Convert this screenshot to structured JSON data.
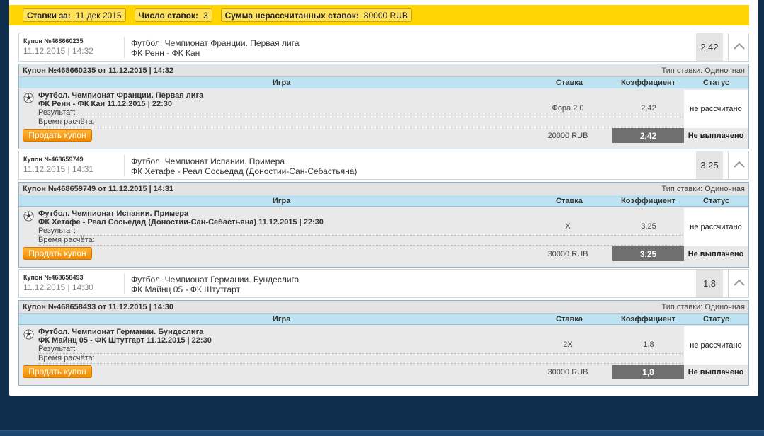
{
  "summary": {
    "bets_for_label": "Ставки за:",
    "bets_for_value": "11 дек 2015",
    "count_label": "Число ставок:",
    "count_value": "3",
    "unsettled_label": "Сумма нерассчитанных ставок:",
    "unsettled_value": "80000 RUB"
  },
  "columns": {
    "game": "Игра",
    "bet": "Ставка",
    "coef": "Коэффициент",
    "status": "Статус"
  },
  "labels": {
    "result": "Результат:",
    "settle_time": "Время расчёта:",
    "sell_button": "Продать купон",
    "bet_type_prefix": "Тип ставки:"
  },
  "coupons": [
    {
      "number": "Купон №468660235",
      "datetime": "11.12.2015 | 14:32",
      "event_line1": "Футбол. Чемпионат Франции. Первая лига",
      "event_line2": "ФК Ренн - ФК Кан",
      "coef": "2,42",
      "detail_title": "Купон №468660235 от 11.12.2015 | 14:32",
      "bet_type": "Тип ставки: Одиночная",
      "detail_event1": "Футбол. Чемпионат Франции. Первая лига",
      "detail_event2": "ФК Ренн - ФК Кан 11.12.2015 | 22:30",
      "bet": "Фора 2 0",
      "bet_coef": "2,42",
      "status": "не рассчитано",
      "stake": "20000 RUB",
      "total_coef": "2,42",
      "payout": "Не выплачено"
    },
    {
      "number": "Купон №468659749",
      "datetime": "11.12.2015 | 14:31",
      "event_line1": "Футбол. Чемпионат Испании. Примера",
      "event_line2": "ФК Хетафе - Реал Сосьедад (Доностии-Сан-Себастьяна)",
      "coef": "3,25",
      "detail_title": "Купон №468659749 от 11.12.2015 | 14:31",
      "bet_type": "Тип ставки: Одиночная",
      "detail_event1": "Футбол. Чемпионат Испании. Примера",
      "detail_event2": "ФК Хетафе - Реал Сосьедад (Доностии-Сан-Себастьяна) 11.12.2015 | 22:30",
      "bet": "X",
      "bet_coef": "3,25",
      "status": "не рассчитано",
      "stake": "30000 RUB",
      "total_coef": "3,25",
      "payout": "Не выплачено"
    },
    {
      "number": "Купон №468658493",
      "datetime": "11.12.2015 | 14:30",
      "event_line1": "Футбол. Чемпионат Германии. Бундеслига",
      "event_line2": "ФК Майнц 05 - ФК Штутгарт",
      "coef": "1,8",
      "detail_title": "Купон №468658493 от 11.12.2015 | 14:30",
      "bet_type": "Тип ставки: Одиночная",
      "detail_event1": "Футбол. Чемпионат Германии. Бундеслига",
      "detail_event2": "ФК Майнц 05 - ФК Штутгарт 11.12.2015 | 22:30",
      "bet": "2X",
      "bet_coef": "1,8",
      "status": "не рассчитано",
      "stake": "30000 RUB",
      "total_coef": "1,8",
      "payout": "Не выплачено"
    }
  ],
  "colors": {
    "summary_bg": "#ffd400",
    "page_bg": "#0e2d4c",
    "sell_button": "#f29400",
    "column_header": "#bde3f3",
    "total_coef_bg": "#6f6f6f"
  }
}
